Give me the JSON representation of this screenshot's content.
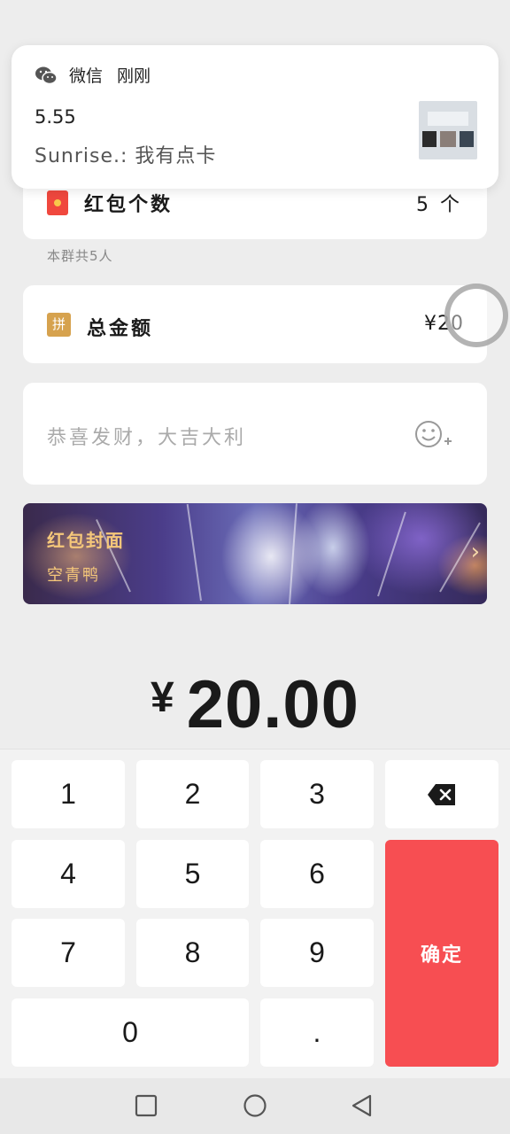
{
  "notification": {
    "app_name": "微信",
    "time": "刚刚",
    "title": "5.55",
    "body": "Sunrise.: 我有点卡"
  },
  "red_packet_count": {
    "label": "红包个数",
    "value": "5",
    "unit": "个"
  },
  "group_note": "本群共5人",
  "total_amount": {
    "icon_text": "拼",
    "label": "总金额",
    "value": "¥20"
  },
  "message": {
    "placeholder": "恭喜发财，大吉大利"
  },
  "cover": {
    "title": "红包封面",
    "subtitle": "空青鸭"
  },
  "amount_display": {
    "symbol": "¥",
    "value": "20.00"
  },
  "keypad": {
    "keys": [
      "1",
      "2",
      "3",
      "4",
      "5",
      "6",
      "7",
      "8",
      "9",
      "0",
      "."
    ],
    "confirm": "确定"
  },
  "colors": {
    "confirm": "#f74e52",
    "cover_text": "#f5c77a",
    "red_icon": "#f0483e"
  }
}
